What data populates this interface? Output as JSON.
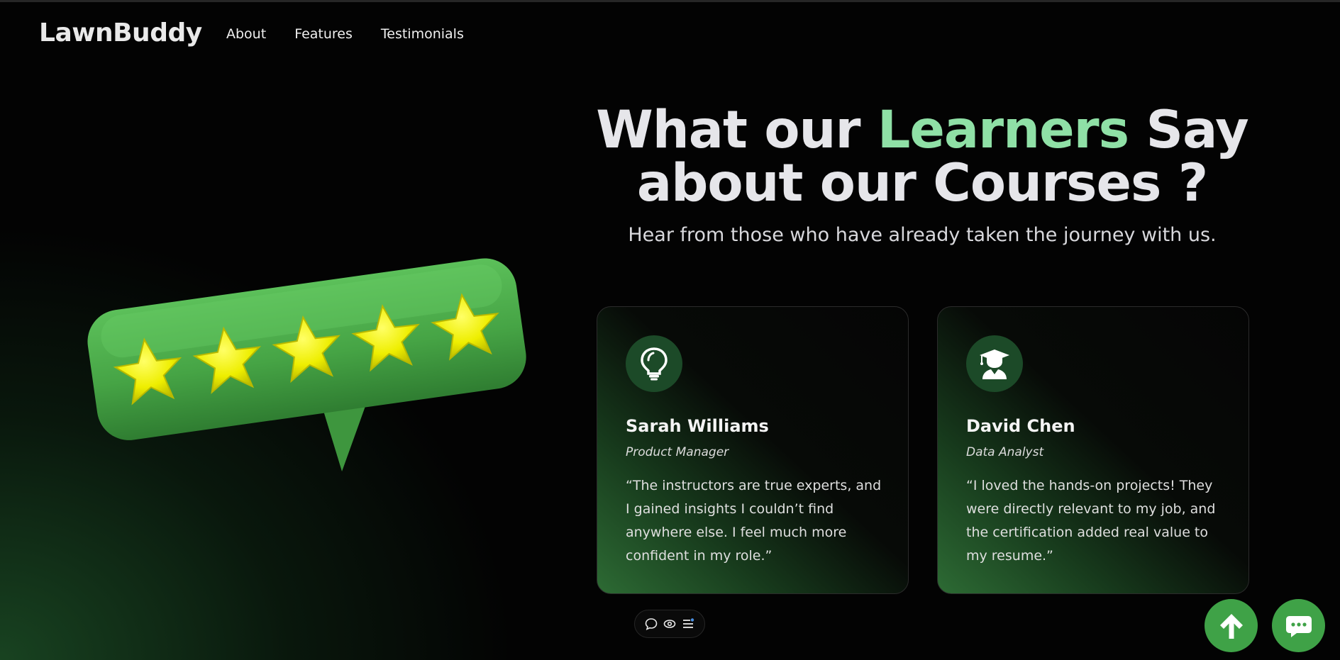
{
  "brand": "LawnBuddy",
  "nav": {
    "items": [
      {
        "label": "About"
      },
      {
        "label": "Features"
      },
      {
        "label": "Testimonials"
      }
    ]
  },
  "hero": {
    "title_part1": "What our ",
    "title_accent": "Learners",
    "title_part2": " Say",
    "title_line2": "about our Courses ?",
    "subtitle": "Hear from those who have already taken the journey with us."
  },
  "rating_graphic": {
    "icon": "five-star-rating-speech-bubble",
    "stars": 5
  },
  "testimonials": [
    {
      "icon": "lightbulb-icon",
      "name": "Sarah Williams",
      "role": "Product Manager",
      "quote": "“The instructors are true experts, and I gained insights I couldn’t find anywhere else. I feel much more confident in my role.”"
    },
    {
      "icon": "graduate-icon",
      "name": "David Chen",
      "role": "Data Analyst",
      "quote": "“I loved the hands-on projects! They were directly relevant to my job, and the certification added real value to my resume.”"
    }
  ],
  "toolbar": {
    "icons": [
      "comment-icon",
      "eye-icon",
      "list-icon"
    ]
  },
  "buttons": {
    "scroll_top_icon": "arrow-up-icon",
    "chat_icon": "chat-bubble-icon"
  },
  "colors": {
    "accent": "#8fe0a6",
    "button_green": "#3fa247",
    "avatar_bg": "#1c4a28",
    "star_yellow": "#f2f200",
    "bubble_green": "#4ca84a"
  }
}
